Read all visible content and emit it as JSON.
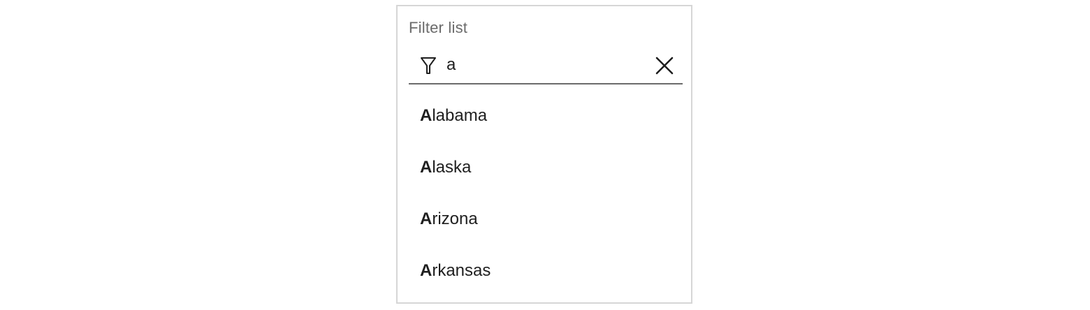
{
  "filter": {
    "label": "Filter list",
    "value": "a",
    "placeholder": ""
  },
  "icons": {
    "filter": "filter-funnel-icon",
    "clear": "close-icon"
  },
  "results": [
    {
      "match": "A",
      "rest": "labama"
    },
    {
      "match": "A",
      "rest": "laska"
    },
    {
      "match": "A",
      "rest": "rizona"
    },
    {
      "match": "A",
      "rest": "rkansas"
    }
  ],
  "colors": {
    "panel_border": "#d6d6d6",
    "label": "#6b6b6b",
    "underline": "#6b6b6b",
    "text": "#1f1f1f"
  }
}
